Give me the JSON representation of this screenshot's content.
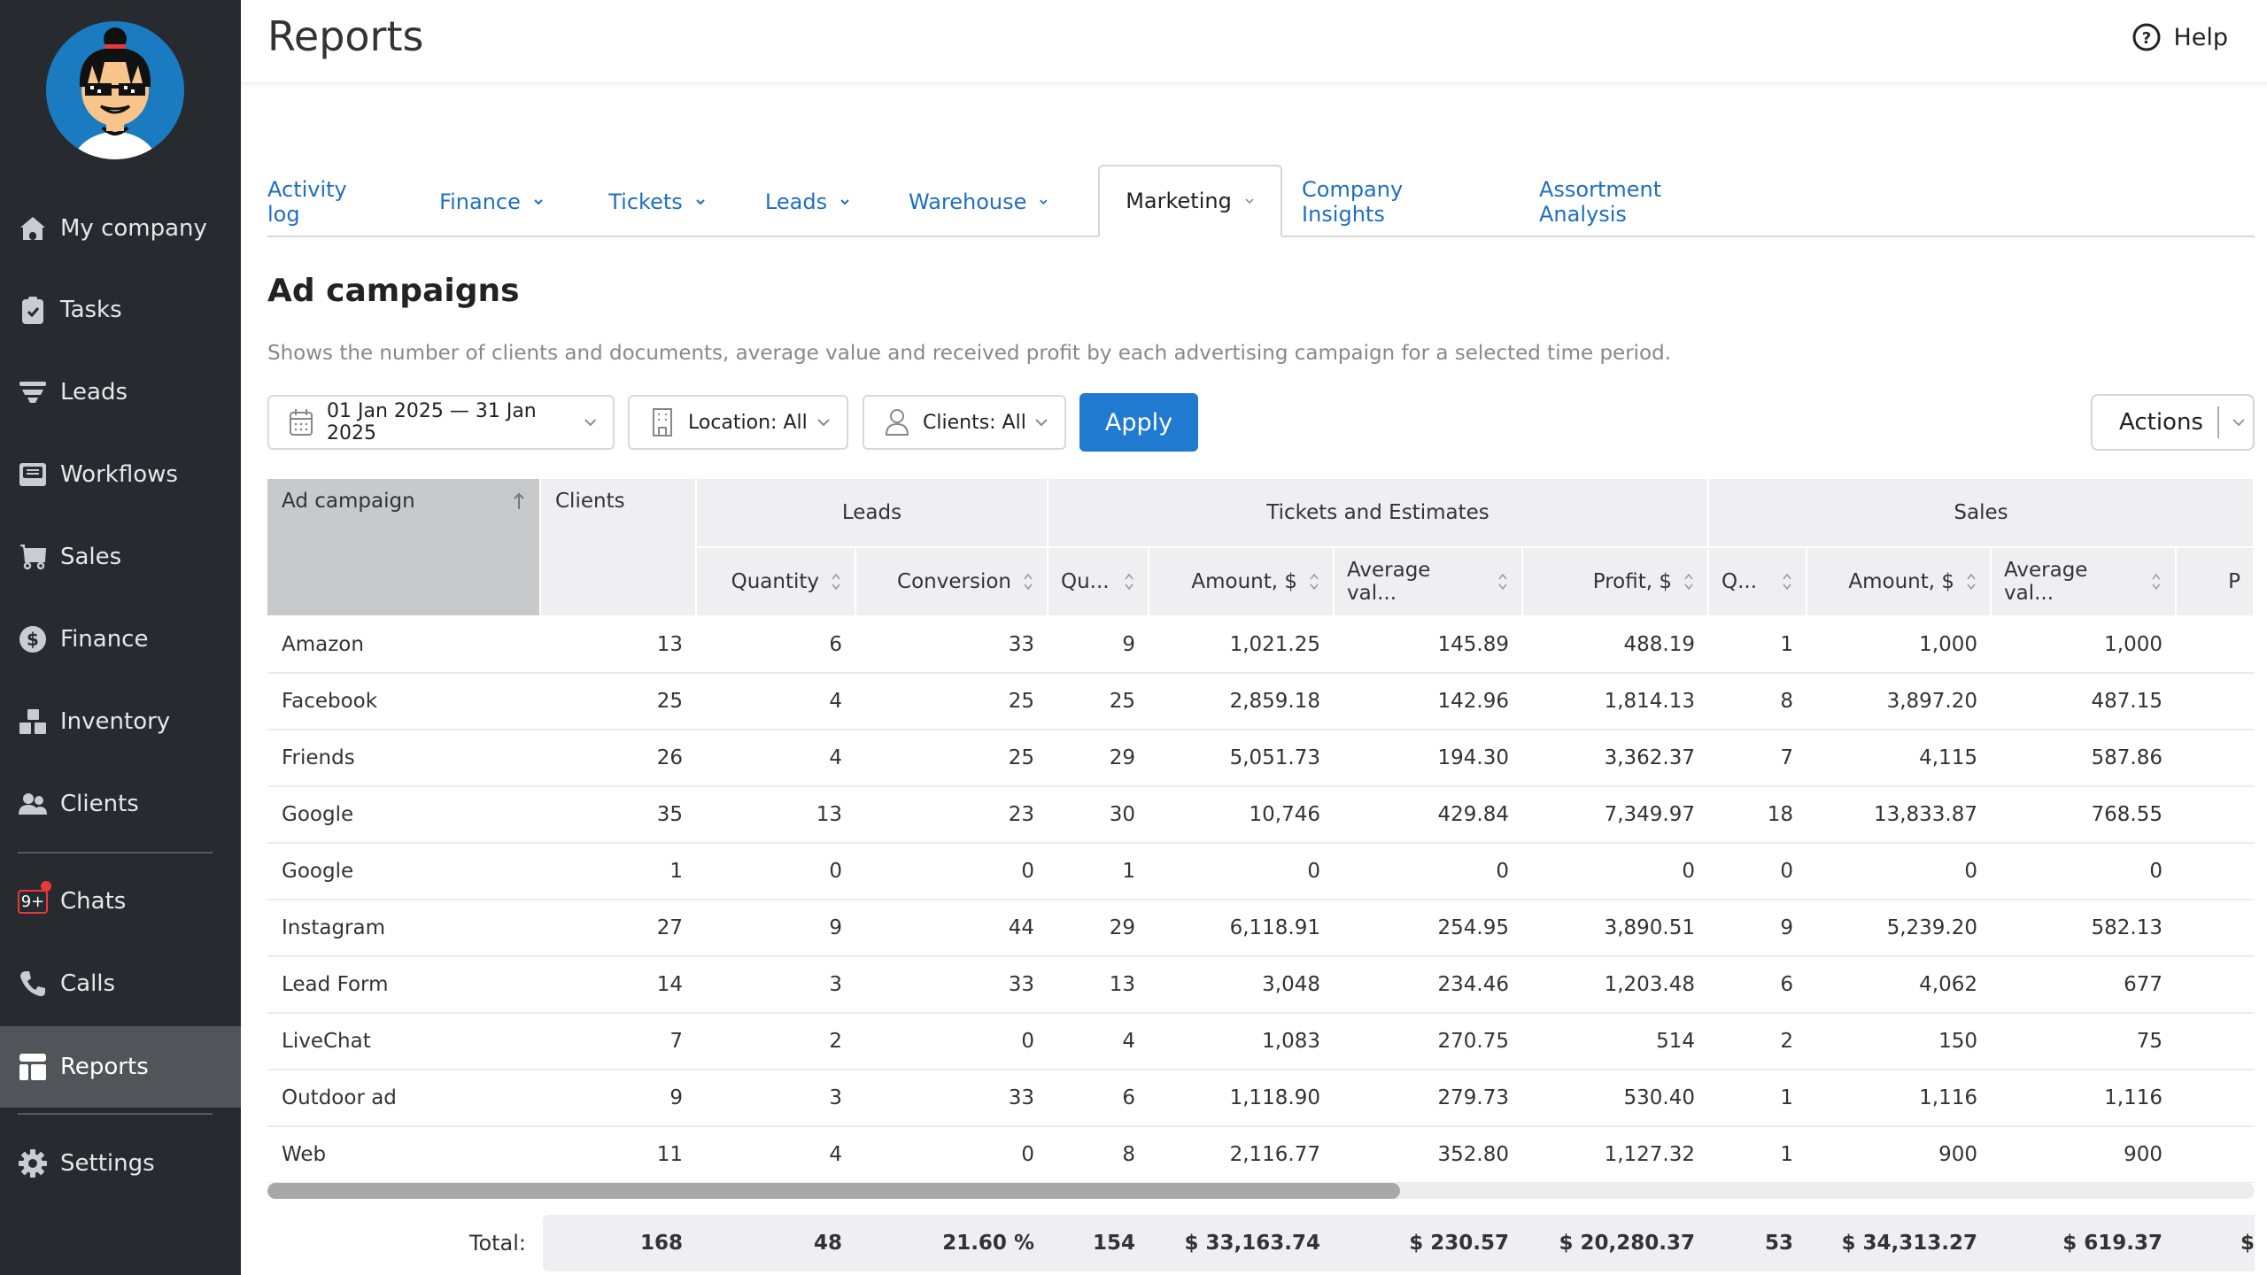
{
  "header": {
    "title": "Reports",
    "help_label": "Help"
  },
  "sidebar": {
    "items": [
      {
        "label": "My company",
        "icon": "home-icon"
      },
      {
        "label": "Tasks",
        "icon": "clipboard-check-icon"
      },
      {
        "label": "Leads",
        "icon": "funnel-icon"
      },
      {
        "label": "Workflows",
        "icon": "inbox-icon"
      },
      {
        "label": "Sales",
        "icon": "cart-icon"
      },
      {
        "label": "Finance",
        "icon": "dollar-circle-icon"
      },
      {
        "label": "Inventory",
        "icon": "boxes-icon"
      },
      {
        "label": "Clients",
        "icon": "users-icon"
      },
      {
        "label": "Chats",
        "icon": "chat-badge-icon",
        "badge": "9+"
      },
      {
        "label": "Calls",
        "icon": "phone-icon"
      },
      {
        "label": "Reports",
        "icon": "reports-icon",
        "active": true
      },
      {
        "label": "Settings",
        "icon": "gear-icon"
      }
    ]
  },
  "tabs": [
    {
      "label": "Activity log",
      "dropdown": false
    },
    {
      "label": "Finance",
      "dropdown": true
    },
    {
      "label": "Tickets",
      "dropdown": true
    },
    {
      "label": "Leads",
      "dropdown": true
    },
    {
      "label": "Warehouse",
      "dropdown": true
    },
    {
      "label": "Marketing",
      "dropdown": true,
      "active": true
    },
    {
      "label": "Company Insights",
      "dropdown": false
    },
    {
      "label": "Assortment Analysis",
      "dropdown": false
    }
  ],
  "section": {
    "title": "Ad campaigns",
    "description": "Shows the number of clients and documents, average value and received profit by each advertising campaign for a selected time period."
  },
  "filters": {
    "date_range": "01 Jan 2025 — 31 Jan 2025",
    "location": "Location: All",
    "clients": "Clients: All",
    "apply_label": "Apply",
    "actions_label": "Actions"
  },
  "table": {
    "group_headers": {
      "leads": "Leads",
      "tickets": "Tickets and Estimates",
      "sales": "Sales"
    },
    "columns": [
      "Ad campaign",
      "Clients",
      "Quantity",
      "Conversion",
      "Qu...",
      "Amount, $",
      "Average val...",
      "Profit, $",
      "Q...",
      "Amount, $",
      "Average val...",
      "P"
    ],
    "rows": [
      [
        "Amazon",
        "13",
        "6",
        "33",
        "9",
        "1,021.25",
        "145.89",
        "488.19",
        "1",
        "1,000",
        "1,000"
      ],
      [
        "Facebook",
        "25",
        "4",
        "25",
        "25",
        "2,859.18",
        "142.96",
        "1,814.13",
        "8",
        "3,897.20",
        "487.15"
      ],
      [
        "Friends",
        "26",
        "4",
        "25",
        "29",
        "5,051.73",
        "194.30",
        "3,362.37",
        "7",
        "4,115",
        "587.86"
      ],
      [
        "Google",
        "35",
        "13",
        "23",
        "30",
        "10,746",
        "429.84",
        "7,349.97",
        "18",
        "13,833.87",
        "768.55"
      ],
      [
        "Google",
        "1",
        "0",
        "0",
        "1",
        "0",
        "0",
        "0",
        "0",
        "0",
        "0"
      ],
      [
        "Instagram",
        "27",
        "9",
        "44",
        "29",
        "6,118.91",
        "254.95",
        "3,890.51",
        "9",
        "5,239.20",
        "582.13"
      ],
      [
        "Lead Form",
        "14",
        "3",
        "33",
        "13",
        "3,048",
        "234.46",
        "1,203.48",
        "6",
        "4,062",
        "677"
      ],
      [
        "LiveChat",
        "7",
        "2",
        "0",
        "4",
        "1,083",
        "270.75",
        "514",
        "2",
        "150",
        "75"
      ],
      [
        "Outdoor ad",
        "9",
        "3",
        "33",
        "6",
        "1,118.90",
        "279.73",
        "530.40",
        "1",
        "1,116",
        "1,116"
      ],
      [
        "Web",
        "11",
        "4",
        "0",
        "8",
        "2,116.77",
        "352.80",
        "1,127.32",
        "1",
        "900",
        "900"
      ]
    ],
    "totals_label": "Total:",
    "totals": [
      "168",
      "48",
      "21.60 %",
      "154",
      "$ 33,163.74",
      "$ 230.57",
      "$ 20,280.37",
      "53",
      "$ 34,313.27",
      "$ 619.37",
      "$"
    ],
    "horizontal_scroll_fraction": 0.57
  },
  "colors": {
    "accent": "#1f7ad0",
    "link": "#1f6fbf",
    "sidebar_bg": "#272b30",
    "sidebar_active": "#51555a",
    "badge": "#e8383d"
  }
}
